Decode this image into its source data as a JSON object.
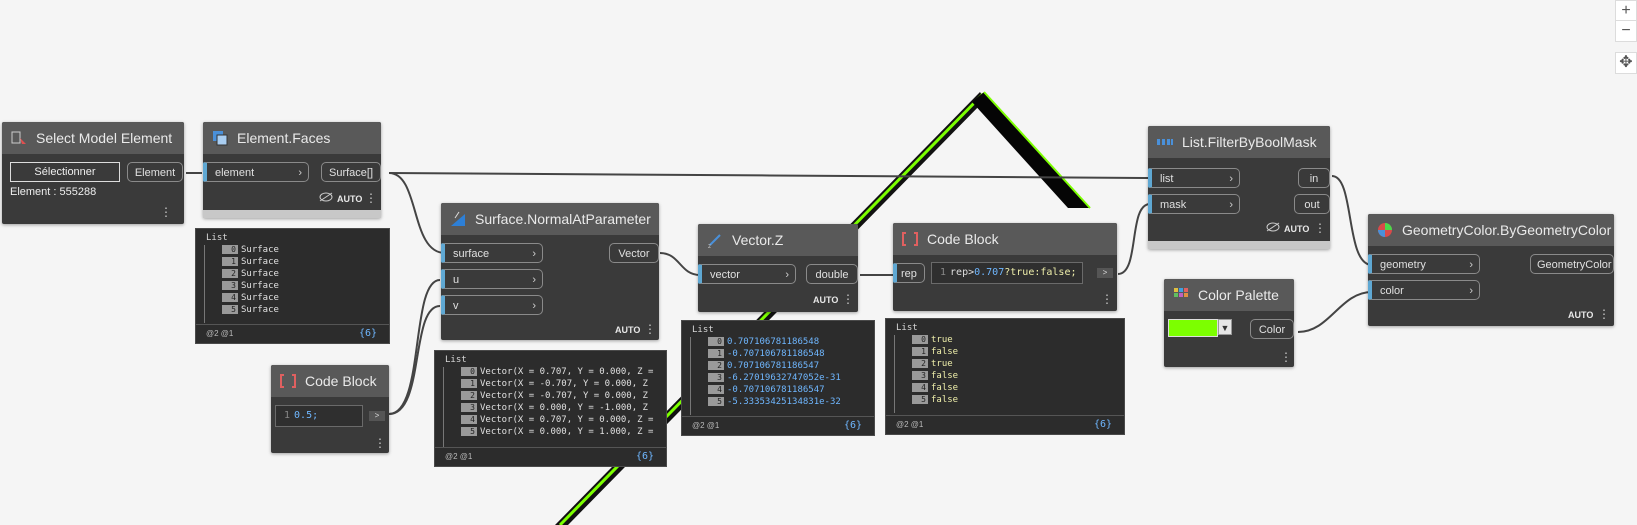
{
  "zoom_controls": {
    "zoom_in": "+",
    "zoom_out": "−",
    "fit": "✥"
  },
  "nodes": {
    "select_model": {
      "title": "Select Model Element",
      "button": "Sélectionner",
      "output": "Element",
      "status": "Element : 555288"
    },
    "element_faces": {
      "title": "Element.Faces",
      "input": "element",
      "output": "Surface[]",
      "run_mode": "AUTO"
    },
    "normal_at_param": {
      "title": "Surface.NormalAtParameter",
      "inputs": [
        "surface",
        "u",
        "v"
      ],
      "output": "Vector",
      "run_mode": "AUTO"
    },
    "code_block_half": {
      "title": "Code Block",
      "line_no": "1",
      "code": "0.5;"
    },
    "vector_z": {
      "title": "Vector.Z",
      "input": "vector",
      "output": "double",
      "run_mode": "AUTO"
    },
    "code_block_rep": {
      "title": "Code Block",
      "input": "rep",
      "line_no": "1",
      "code_var": "rep>",
      "code_num": "0.707",
      "code_rest": "?true:false;"
    },
    "filter_mask": {
      "title": "List.FilterByBoolMask",
      "inputs": [
        "list",
        "mask"
      ],
      "outputs": [
        "in",
        "out"
      ],
      "run_mode": "AUTO"
    },
    "color_palette": {
      "title": "Color Palette",
      "output": "Color",
      "swatch": "#7cff00"
    },
    "geometry_color": {
      "title": "GeometryColor.ByGeometryColor",
      "inputs": [
        "geometry",
        "color"
      ],
      "output": "GeometryColor",
      "run_mode": "AUTO"
    }
  },
  "previews": {
    "faces": {
      "header": "List",
      "items": [
        "Surface",
        "Surface",
        "Surface",
        "Surface",
        "Surface",
        "Surface"
      ],
      "level": "@2 @1",
      "count": "{6}"
    },
    "normals": {
      "header": "List",
      "items": [
        "Vector(X = 0.707, Y = 0.000, Z =",
        "Vector(X = -0.707, Y = 0.000, Z",
        "Vector(X = -0.707, Y = 0.000, Z",
        "Vector(X = 0.000, Y = -1.000, Z",
        "Vector(X = 0.707, Y = 0.000, Z =",
        "Vector(X = 0.000, Y = 1.000, Z ="
      ],
      "level": "@2 @1",
      "count": "{6}"
    },
    "zvals": {
      "header": "List",
      "items": [
        "0.707106781186548",
        "-0.707106781186548",
        "0.707106781186547",
        "-6.27019632747052e-31",
        "-0.707106781186547",
        "-5.33353425134831e-32"
      ],
      "level": "@2 @1",
      "count": "{6}"
    },
    "bools": {
      "header": "List",
      "items": [
        "true",
        "false",
        "true",
        "false",
        "false",
        "false"
      ],
      "level": "@2 @1",
      "count": "{6}"
    }
  },
  "colors": {
    "canvas": "#f5f5f5",
    "node_body": "#3a3a3a",
    "node_header": "#595959",
    "port_accent": "#5fa8d3",
    "geometry_green": "#7cff00"
  }
}
